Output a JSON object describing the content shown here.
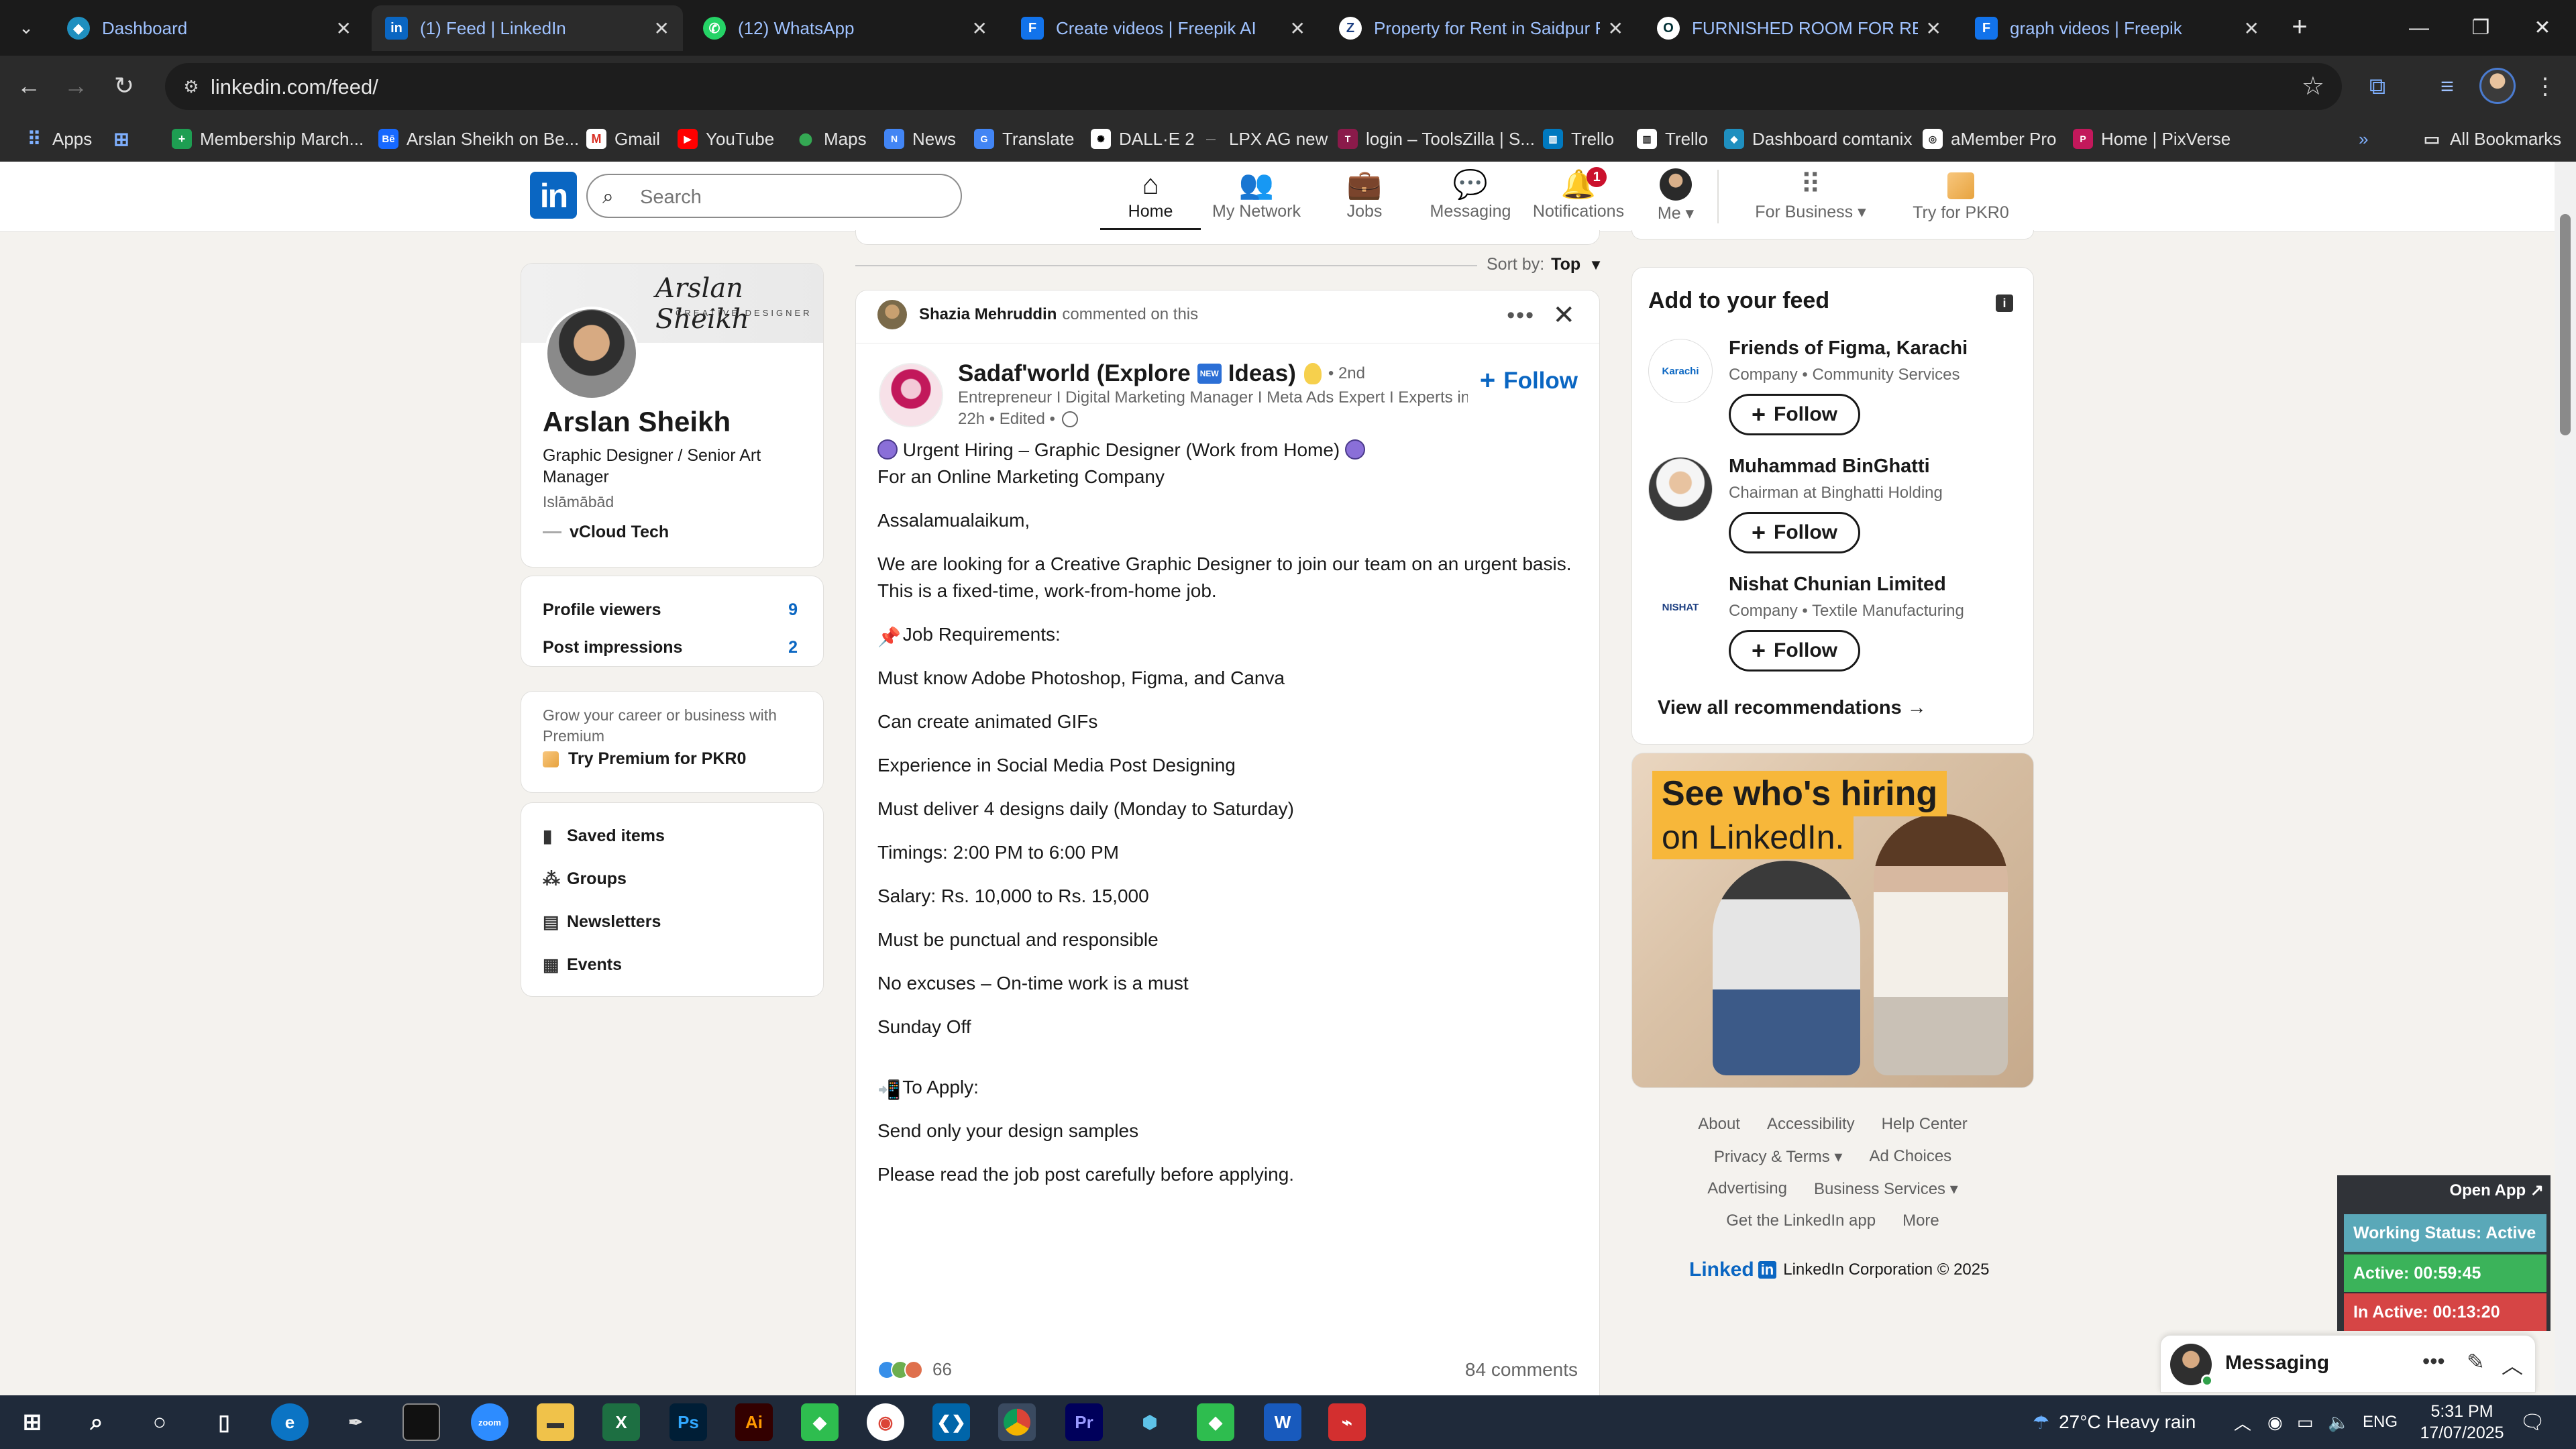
{
  "browser": {
    "tabs": [
      {
        "title": "Dashboard",
        "icon": "dashboard-favicon",
        "color": "#1f8fbf"
      },
      {
        "title": "(1) Feed | LinkedIn",
        "icon": "linkedin-favicon",
        "color": "#0a66c2"
      },
      {
        "title": "(12) WhatsApp",
        "icon": "whatsapp-favicon",
        "color": "#25d366"
      },
      {
        "title": "Create videos | Freepik AI",
        "icon": "freepik-favicon",
        "color": "#1273eb"
      },
      {
        "title": "Property for Rent in Saidpur Ro",
        "icon": "property-favicon",
        "color": "#ffffff"
      },
      {
        "title": "FURNISHED ROOM FOR RENT",
        "icon": "olx-favicon",
        "color": "#ffffff"
      },
      {
        "title": "graph videos | Freepik",
        "icon": "freepik-favicon",
        "color": "#1273eb"
      }
    ],
    "url": "linkedin.com/feed/",
    "bookmarks": [
      {
        "label": "Apps"
      },
      {
        "label": ""
      },
      {
        "label": "Membership March..."
      },
      {
        "label": "Arslan Sheikh on Be..."
      },
      {
        "label": "Gmail"
      },
      {
        "label": "YouTube"
      },
      {
        "label": "Maps"
      },
      {
        "label": "News"
      },
      {
        "label": "Translate"
      },
      {
        "label": "DALL·E 2"
      },
      {
        "label": "LPX AG new"
      },
      {
        "label": "login – ToolsZilla | S..."
      },
      {
        "label": "Trello"
      },
      {
        "label": "Trello"
      },
      {
        "label": "Dashboard comtanix"
      },
      {
        "label": "aMember Pro"
      },
      {
        "label": "Home | PixVerse"
      }
    ],
    "all_bookmarks": "All Bookmarks"
  },
  "header": {
    "logo": "in",
    "search_placeholder": "Search",
    "nav": [
      {
        "label": "Home",
        "icon": "home-icon"
      },
      {
        "label": "My Network",
        "icon": "network-icon"
      },
      {
        "label": "Jobs",
        "icon": "briefcase-icon"
      },
      {
        "label": "Messaging",
        "icon": "messaging-icon"
      },
      {
        "label": "Notifications",
        "icon": "bell-icon",
        "badge": "1"
      },
      {
        "label": "Me ▾",
        "icon": "avatar"
      },
      {
        "label": "For Business ▾",
        "icon": "grid-icon"
      },
      {
        "label": "Try for PKR0",
        "icon": "premium-icon"
      }
    ]
  },
  "profile": {
    "banner_signature": "Arslan Sheikh",
    "banner_subtitle": "CREATIVE DESIGNER",
    "name": "Arslan Sheikh",
    "headline": "Graphic Designer / Senior Art Manager",
    "location": "Islāmābād",
    "company": "vCloud Tech",
    "stats": [
      {
        "label": "Profile viewers",
        "value": "9"
      },
      {
        "label": "Post impressions",
        "value": "2"
      }
    ],
    "premium_text": "Grow your career or business with Premium",
    "premium_cta": "Try Premium for PKR0",
    "links": [
      {
        "label": "Saved items",
        "icon": "bookmark-icon"
      },
      {
        "label": "Groups",
        "icon": "groups-icon"
      },
      {
        "label": "Newsletters",
        "icon": "newsletter-icon"
      },
      {
        "label": "Events",
        "icon": "calendar-icon"
      }
    ]
  },
  "feed": {
    "sort_label": "Sort by:",
    "sort_value": "Top",
    "post": {
      "commenter": "Shazia Mehruddin",
      "commenter_action": "commented on this",
      "author_name": "Sadaf'world (Explore",
      "author_name_suffix": "Ideas)",
      "badge_text": "NEW",
      "degree": "• 2nd",
      "author_sub": "Entrepreneur I Digital Marketing Manager I Meta Ads Expert I Experts in...",
      "time": "22h • Edited •",
      "follow": "Follow",
      "lines": [
        {
          "text": "Urgent Hiring – Graphic Designer (Work from Home)",
          "deco": "circles"
        },
        {
          "text": "For an Online Marketing Company"
        },
        {
          "text": ""
        },
        {
          "text": "Assalamualaikum,"
        },
        {
          "text": ""
        },
        {
          "text": "We are looking for a Creative Graphic Designer to join our team on an urgent basis."
        },
        {
          "text": "This is a fixed-time, work-from-home job."
        },
        {
          "text": ""
        },
        {
          "text": "Job Requirements:",
          "deco": "pin"
        },
        {
          "text": ""
        },
        {
          "text": "Must know Adobe Photoshop, Figma, and Canva"
        },
        {
          "text": ""
        },
        {
          "text": "Can create animated GIFs"
        },
        {
          "text": ""
        },
        {
          "text": "Experience in Social Media Post Designing"
        },
        {
          "text": ""
        },
        {
          "text": "Must deliver 4 designs daily (Monday to Saturday)"
        },
        {
          "text": ""
        },
        {
          "text": "Timings: 2:00 PM to 6:00 PM"
        },
        {
          "text": ""
        },
        {
          "text": "Salary: Rs. 10,000 to Rs. 15,000"
        },
        {
          "text": ""
        },
        {
          "text": "Must be punctual and responsible"
        },
        {
          "text": ""
        },
        {
          "text": "No excuses – On-time work is a must"
        },
        {
          "text": ""
        },
        {
          "text": "Sunday Off"
        },
        {
          "text": ""
        },
        {
          "text": ""
        },
        {
          "text": "To Apply:",
          "deco": "phone"
        },
        {
          "text": ""
        },
        {
          "text": "Send only your design samples"
        },
        {
          "text": ""
        },
        {
          "text": "Please read the job post carefully before applying."
        }
      ],
      "reactions_count": "66",
      "comments": "84 comments"
    }
  },
  "rail": {
    "title": "Add to your feed",
    "recs": [
      {
        "name": "Friends of Figma, Karachi",
        "sub": "Company • Community Services",
        "logo": "Karachi",
        "follow": "Follow"
      },
      {
        "name": "Muhammad BinGhatti",
        "sub": "Chairman at Binghatti Holding",
        "logo": "",
        "follow": "Follow"
      },
      {
        "name": "Nishat Chunian Limited",
        "sub": "Company • Textile Manufacturing",
        "logo": "NISHAT",
        "follow": "Follow"
      }
    ],
    "view_all": "View all recommendations →",
    "ad_line1": "See who's hiring",
    "ad_line2": "on LinkedIn.",
    "footer": {
      "row1": [
        "About",
        "Accessibility",
        "Help Center"
      ],
      "row2": [
        "Privacy & Terms ▾",
        "Ad Choices"
      ],
      "row3": [
        "Advertising",
        "Business Services ▾"
      ],
      "row4": [
        "Get the LinkedIn app",
        "More"
      ],
      "brand_word": "Linked",
      "brand_in": "in",
      "copyright": "LinkedIn Corporation © 2025"
    }
  },
  "widget": {
    "open": "Open App ↗",
    "status": "Working Status: Active",
    "active": "Active: 00:59:45",
    "inactive": "In Active: 00:13:20",
    "colors": {
      "status": "#5aa8b8",
      "active": "#3bb35a",
      "inactive": "#d64545"
    }
  },
  "messaging": {
    "title": "Messaging"
  },
  "taskbar": {
    "weather": "27°C  Heavy rain",
    "lang": "ENG",
    "time": "5:31 PM",
    "date": "17/07/2025"
  }
}
